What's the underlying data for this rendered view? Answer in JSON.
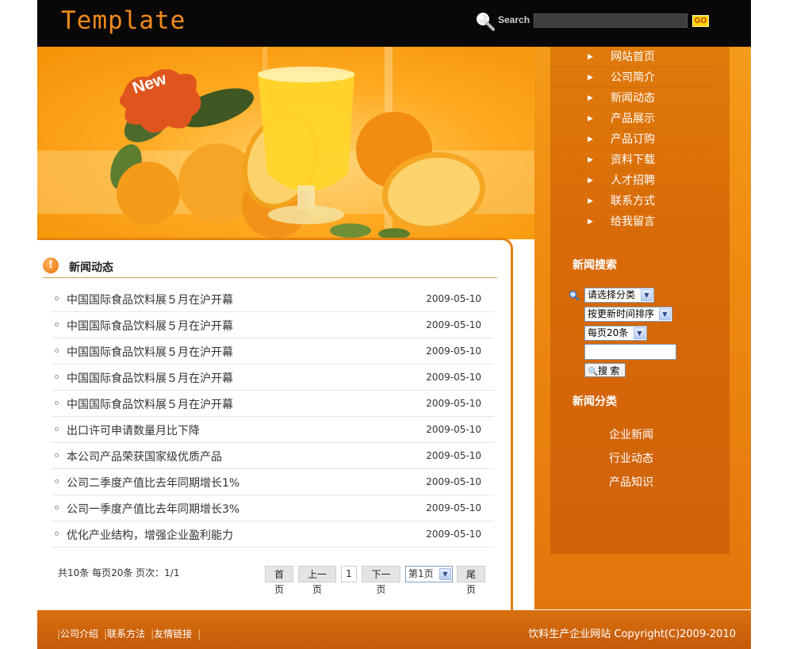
{
  "header": {
    "logo_text": "Template",
    "search_label": "Search",
    "go_label": "GO"
  },
  "banner": {
    "badge_text": "New"
  },
  "nav": {
    "items": [
      {
        "label": "网站首页"
      },
      {
        "label": "公司简介"
      },
      {
        "label": "新闻动态"
      },
      {
        "label": "产品展示"
      },
      {
        "label": "产品订购"
      },
      {
        "label": "资料下载"
      },
      {
        "label": "人才招聘"
      },
      {
        "label": "联系方式"
      },
      {
        "label": "给我留言"
      }
    ]
  },
  "news_search": {
    "title": "新闻搜索",
    "category_select": "请选择分类",
    "sort_select": "按更新时间排序",
    "per_page_select": "每页20条",
    "keyword_value": "",
    "search_button": "搜 索"
  },
  "news_categories": {
    "title": "新闻分类",
    "items": [
      "企业新闻",
      "行业动态",
      "产品知识"
    ]
  },
  "content": {
    "title": "新闻动态",
    "news": [
      {
        "title": "中国国际食品饮料展５月在沪开幕",
        "date": "2009-05-10"
      },
      {
        "title": "中国国际食品饮料展５月在沪开幕",
        "date": "2009-05-10"
      },
      {
        "title": "中国国际食品饮料展５月在沪开幕",
        "date": "2009-05-10"
      },
      {
        "title": "中国国际食品饮料展５月在沪开幕",
        "date": "2009-05-10"
      },
      {
        "title": "中国国际食品饮料展５月在沪开幕",
        "date": "2009-05-10"
      },
      {
        "title": "出口许可申请数量月比下降",
        "date": "2009-05-10"
      },
      {
        "title": "本公司产品荣获国家级优质产品",
        "date": "2009-05-10"
      },
      {
        "title": "公司二季度产值比去年同期增长1%",
        "date": "2009-05-10"
      },
      {
        "title": "公司一季度产值比去年同期增长3%",
        "date": "2009-05-10"
      },
      {
        "title": "优化产业结构，增强企业盈利能力",
        "date": "2009-05-10"
      }
    ]
  },
  "pager": {
    "info": "共10条 每页20条 页次：1/1",
    "first": "首页",
    "prev": "上一页",
    "current": "1",
    "next": "下一页",
    "page_select": "第1页",
    "last": "尾页"
  },
  "footer": {
    "links": [
      "公司介绍",
      "联系方法",
      "友情链接"
    ],
    "copyright": "饮料生产企业网站  Copyright(C)2009-2010"
  },
  "colors": {
    "accent": "#f08a1c",
    "header_bg": "#0a0806",
    "footer_bg": "#c45a0a"
  }
}
